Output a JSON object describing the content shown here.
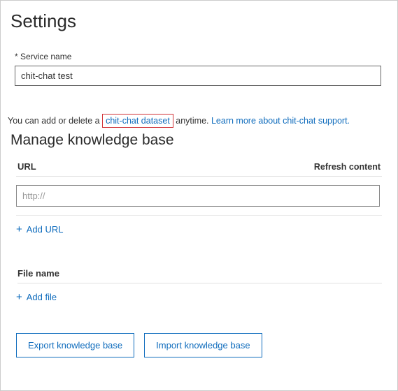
{
  "settings": {
    "title": "Settings",
    "serviceNameLabel": "Service name",
    "serviceNameValue": "chit-chat test"
  },
  "hint": {
    "prefix": "You can add or delete a ",
    "highlightedLink": "chit-chat dataset",
    "middle": " anytime. ",
    "learnMore": "Learn more about chit-chat support."
  },
  "manage": {
    "title": "Manage knowledge base",
    "urlHeader": "URL",
    "refreshHeader": "Refresh content",
    "urlPlaceholder": "http://",
    "addUrl": "Add URL",
    "fileHeader": "File name",
    "addFile": "Add file"
  },
  "footer": {
    "export": "Export knowledge base",
    "import": "Import knowledge base"
  }
}
